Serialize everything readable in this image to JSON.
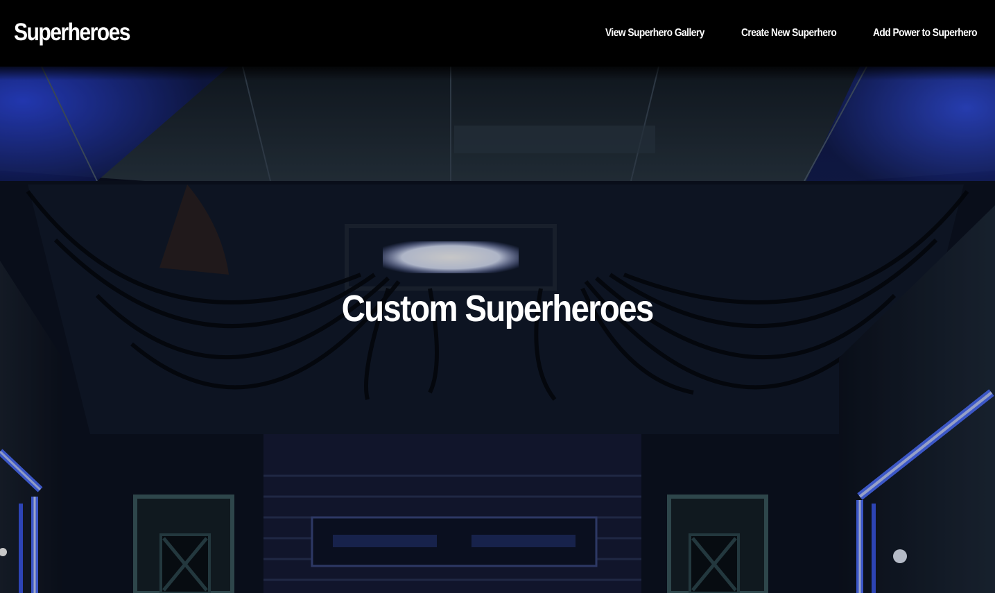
{
  "navbar": {
    "brand": "Superheroes",
    "links": [
      {
        "label": "View Superhero Gallery"
      },
      {
        "label": "Create New Superhero"
      },
      {
        "label": "Add Power to Superhero"
      }
    ]
  },
  "hero": {
    "title": "Custom Superheroes",
    "background_image": "dark sci-fi corridor with blue neon lights and hanging cables"
  },
  "colors": {
    "navbar_bg": "#000000",
    "text": "#ffffff",
    "neon_blue": "#2a4cff"
  }
}
